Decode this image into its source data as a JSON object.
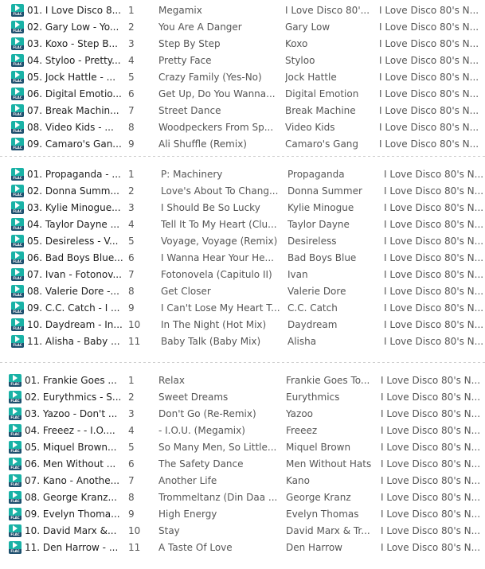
{
  "icon": {
    "name": "flac-file-icon",
    "label": "FLAC",
    "color": "#19b2a6",
    "strip_color": "#1e4e6d"
  },
  "groups": [
    {
      "rows": [
        {
          "name": "01. I Love Disco 8...",
          "num": "1",
          "title": "Megamix",
          "artist": "I Love Disco 80'...",
          "album": "I Love Disco 80's N..."
        },
        {
          "name": "02. Gary Low - Yo...",
          "num": "2",
          "title": "You Are A Danger",
          "artist": "Gary Low",
          "album": "I Love Disco 80's N..."
        },
        {
          "name": "03. Koxo - Step B...",
          "num": "3",
          "title": "Step By Step",
          "artist": "Koxo",
          "album": "I Love Disco 80's N..."
        },
        {
          "name": "04. Styloo - Pretty...",
          "num": "4",
          "title": "Pretty Face",
          "artist": "Styloo",
          "album": "I Love Disco 80's N..."
        },
        {
          "name": "05. Jock Hattle - ...",
          "num": "5",
          "title": "Crazy Family (Yes-No)",
          "artist": "Jock Hattle",
          "album": "I Love Disco 80's N..."
        },
        {
          "name": "06. Digital Emotio...",
          "num": "6",
          "title": "Get Up, Do You Wanna...",
          "artist": "Digital Emotion",
          "album": "I Love Disco 80's N..."
        },
        {
          "name": "07. Break Machin...",
          "num": "7",
          "title": "Street Dance",
          "artist": "Break Machine",
          "album": "I Love Disco 80's N..."
        },
        {
          "name": "08. Video Kids - ...",
          "num": "8",
          "title": "Woodpeckers From Sp...",
          "artist": "Video Kids",
          "album": "I Love Disco 80's N..."
        },
        {
          "name": "09. Camaro's Gan...",
          "num": "9",
          "title": "Ali Shuffle (Remix)",
          "artist": "Camaro's Gang",
          "album": "I Love Disco 80's N..."
        }
      ]
    },
    {
      "rows": [
        {
          "name": "01. Propaganda - ...",
          "num": "1",
          "title": "P: Machinery",
          "artist": "Propaganda",
          "album": "I Love Disco 80's N..."
        },
        {
          "name": "02. Donna Summ...",
          "num": "2",
          "title": "Love's About To Chang...",
          "artist": "Donna Summer",
          "album": "I Love Disco 80's N..."
        },
        {
          "name": "03. Kylie Minogue...",
          "num": "3",
          "title": "I Should Be So Lucky",
          "artist": "Kylie Minogue",
          "album": "I Love Disco 80's N..."
        },
        {
          "name": "04. Taylor Dayne ...",
          "num": "4",
          "title": "Tell It To My Heart (Clu...",
          "artist": "Taylor Dayne",
          "album": "I Love Disco 80's N..."
        },
        {
          "name": "05. Desireless - V...",
          "num": "5",
          "title": "Voyage, Voyage (Remix)",
          "artist": "Desireless",
          "album": "I Love Disco 80's N..."
        },
        {
          "name": "06. Bad Boys Blue...",
          "num": "6",
          "title": "I Wanna Hear Your He...",
          "artist": "Bad Boys Blue",
          "album": "I Love Disco 80's N..."
        },
        {
          "name": "07. Ivan - Fotonov...",
          "num": "7",
          "title": "Fotonovela (Capitulo II)",
          "artist": "Ivan",
          "album": "I Love Disco 80's N..."
        },
        {
          "name": "08. Valerie Dore -...",
          "num": "8",
          "title": "Get Closer",
          "artist": "Valerie Dore",
          "album": "I Love Disco 80's N..."
        },
        {
          "name": "09. C.C. Catch - I ...",
          "num": "9",
          "title": "I Can't Lose My Heart T...",
          "artist": "C.C. Catch",
          "album": "I Love Disco 80's N..."
        },
        {
          "name": "10. Daydream - In...",
          "num": "10",
          "title": "In The Night (Hot Mix)",
          "artist": "Daydream",
          "album": "I Love Disco 80's N..."
        },
        {
          "name": "11. Alisha - Baby ...",
          "num": "11",
          "title": "Baby Talk (Baby Mix)",
          "artist": "Alisha",
          "album": "I Love Disco 80's N..."
        }
      ]
    },
    {
      "rows": [
        {
          "name": "01. Frankie Goes ...",
          "num": "1",
          "title": "Relax",
          "artist": "Frankie Goes To...",
          "album": "I Love Disco 80's N..."
        },
        {
          "name": "02. Eurythmics - S...",
          "num": "2",
          "title": "Sweet Dreams",
          "artist": "Eurythmics",
          "album": "I Love Disco 80's N..."
        },
        {
          "name": "03. Yazoo - Don't ...",
          "num": "3",
          "title": "Don't Go (Re-Remix)",
          "artist": "Yazoo",
          "album": "I Love Disco 80's N..."
        },
        {
          "name": "04. Freeez - - I.O....",
          "num": "4",
          "title": "- I.O.U. (Megamix)",
          "artist": "Freeez",
          "album": "I Love Disco 80's N..."
        },
        {
          "name": "05. Miquel Brown...",
          "num": "5",
          "title": "So Many Men, So Little...",
          "artist": "Miquel Brown",
          "album": "I Love Disco 80's N..."
        },
        {
          "name": "06. Men Without ...",
          "num": "6",
          "title": "The Safety Dance",
          "artist": "Men Without Hats",
          "album": "I Love Disco 80's N..."
        },
        {
          "name": "07. Kano - Anothe...",
          "num": "7",
          "title": "Another Life",
          "artist": "Kano",
          "album": "I Love Disco 80's N..."
        },
        {
          "name": "08. George Kranz...",
          "num": "8",
          "title": "Trommeltanz (Din Daa ...",
          "artist": "George Kranz",
          "album": "I Love Disco 80's N..."
        },
        {
          "name": "09. Evelyn Thoma...",
          "num": "9",
          "title": "High Energy",
          "artist": "Evelyn Thomas",
          "album": "I Love Disco 80's N..."
        },
        {
          "name": "10. David Marx &...",
          "num": "10",
          "title": "Stay",
          "artist": "David Marx & Tr...",
          "album": "I Love Disco 80's N..."
        },
        {
          "name": "11. Den Harrow - ...",
          "num": "11",
          "title": "A Taste Of Love",
          "artist": "Den Harrow",
          "album": "I Love Disco 80's N..."
        }
      ]
    }
  ]
}
